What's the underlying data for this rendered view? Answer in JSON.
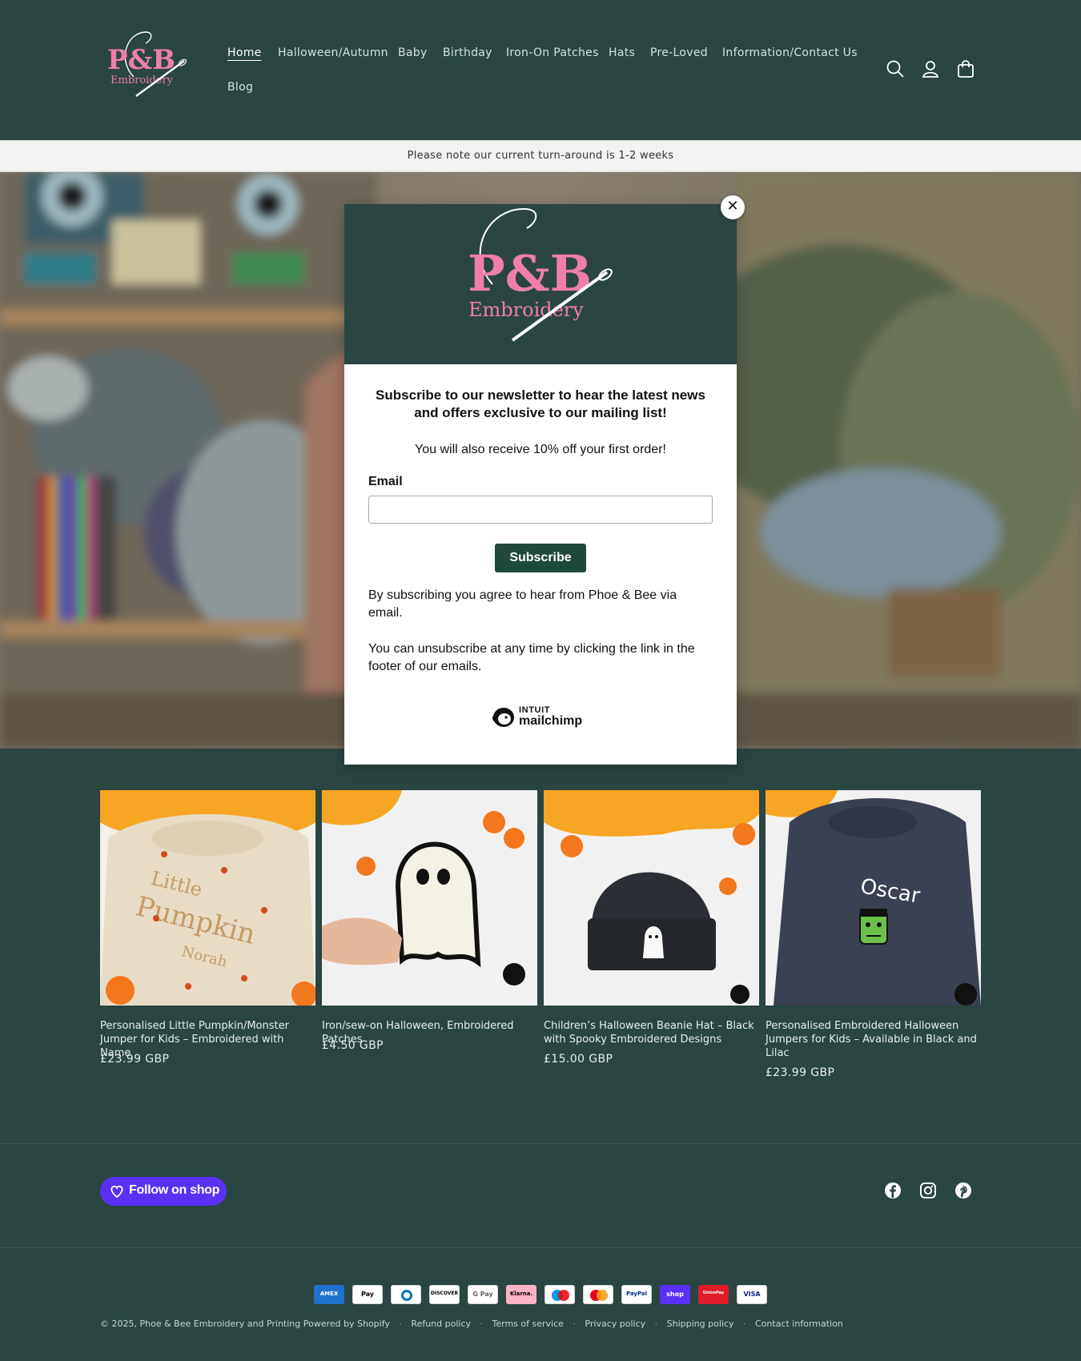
{
  "header": {
    "logo_alt": "P&B Embroidery",
    "nav": [
      {
        "label": "Home",
        "active": true
      },
      {
        "label": "Halloween/Autumn"
      },
      {
        "label": "Baby"
      },
      {
        "label": "Birthday"
      },
      {
        "label": "Iron-On Patches"
      },
      {
        "label": "Hats"
      },
      {
        "label": "Pre-Loved"
      },
      {
        "label": "Information/Contact Us"
      },
      {
        "label": "Blog"
      }
    ],
    "icons": [
      "search-icon",
      "account-icon",
      "cart-icon"
    ]
  },
  "announcement": "Please note our current turn-around is 1-2 weeks",
  "modal": {
    "logo_line1": "P&B",
    "logo_line2": "Embroidery",
    "headline": "Subscribe to our newsletter to hear the latest news and offers exclusive to our mailing list!",
    "subline": "You will also receive 10% off your first order!",
    "email_label": "Email",
    "email_value": "",
    "subscribe_label": "Subscribe",
    "consent": "By subscribing you agree to hear from Phoe & Bee via email.",
    "unsubscribe": "You can unsubscribe at any time by clicking the link in the footer of our emails.",
    "mailchimp_top": "INTUIT",
    "mailchimp_word": "mailchimp"
  },
  "products": [
    {
      "title": "Personalised Little Pumpkin/Monster Jumper for Kids – Embroidered with Name",
      "price": "£23.99 GBP"
    },
    {
      "title": "Iron/sew-on Halloween, Embroidered Patches",
      "price": "£4.50 GBP"
    },
    {
      "title": "Children’s Halloween Beanie Hat – Black with Spooky Embroidered Designs",
      "price": "£15.00 GBP"
    },
    {
      "title": "Personalised Embroidered Halloween Jumpers for Kids – Available in Black and Lilac",
      "price": "£23.99 GBP"
    }
  ],
  "product_image_text": {
    "jumper1_line1": "Little",
    "jumper1_line2": "Pumpkin",
    "jumper1_line3": "Norah",
    "jumper4_name": "Oscar"
  },
  "footer": {
    "follow_label": "Follow on shop",
    "socials": [
      "facebook-icon",
      "instagram-icon",
      "pinterest-icon"
    ],
    "payments": [
      "AMEX",
      "Pay",
      "Diners",
      "DISCOVER",
      "G Pay",
      "Klarna.",
      "Maestro",
      "Mastercard",
      "PayPal",
      "shop",
      "UnionPay",
      "VISA"
    ],
    "copyright": "© 2025,",
    "store_link": "Phoe & Bee Embroidery and Printing",
    "powered": "Powered by Shopify",
    "links": [
      "Refund policy",
      "Terms of service",
      "Privacy policy",
      "Shipping policy",
      "Contact information"
    ]
  },
  "colors": {
    "background": "#2a4542",
    "brand_pink": "#ef7fa8",
    "subscribe_button": "#1f4a3a",
    "shop_purple": "#5a31f4"
  }
}
